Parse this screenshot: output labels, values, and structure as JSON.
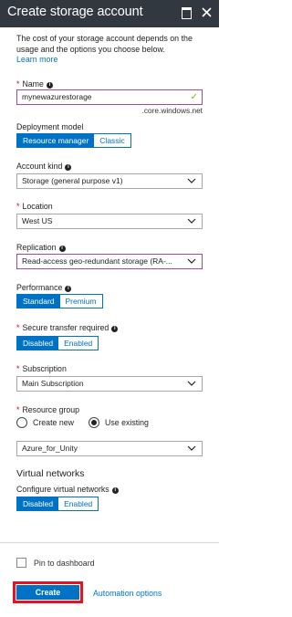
{
  "window": {
    "title": "Create storage account"
  },
  "intro": {
    "text": "The cost of your storage account depends on the usage and the options you choose below.",
    "link": "Learn more"
  },
  "name": {
    "label": "Name",
    "value": "mynewazurestorage",
    "suffix": ".core.windows.net"
  },
  "deployment_model": {
    "label": "Deployment model",
    "options": [
      "Resource manager",
      "Classic"
    ],
    "selected": "Resource manager"
  },
  "account_kind": {
    "label": "Account kind",
    "value": "Storage (general purpose v1)"
  },
  "location": {
    "label": "Location",
    "value": "West US"
  },
  "replication": {
    "label": "Replication",
    "value": "Read-access geo-redundant storage (RA-..."
  },
  "performance": {
    "label": "Performance",
    "options": [
      "Standard",
      "Premium"
    ],
    "selected": "Standard"
  },
  "secure_transfer": {
    "label": "Secure transfer required",
    "options": [
      "Disabled",
      "Enabled"
    ],
    "selected": "Disabled"
  },
  "subscription": {
    "label": "Subscription",
    "value": "Main Subscription"
  },
  "resource_group": {
    "label": "Resource group",
    "options": [
      "Create new",
      "Use existing"
    ],
    "selected": "Use existing",
    "value": "Azure_for_Unity"
  },
  "virtual_networks": {
    "heading": "Virtual networks",
    "label": "Configure virtual networks",
    "options": [
      "Disabled",
      "Enabled"
    ],
    "selected": "Disabled"
  },
  "footer": {
    "pin_label": "Pin to dashboard",
    "create_label": "Create",
    "automation_label": "Automation options"
  },
  "colors": {
    "titlebar": "#32383f",
    "accent": "#0072c6",
    "required": "#e00000",
    "highlight_border": "#e81123",
    "focus_border": "#9b4f96",
    "valid_check": "#7fba00"
  }
}
